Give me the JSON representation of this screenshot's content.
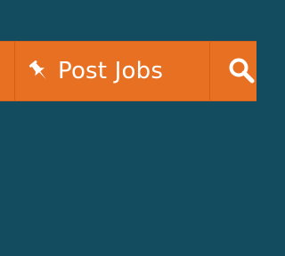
{
  "nav": {
    "post_jobs_label": "Post Jobs",
    "post_jobs_icon": "pushpin-icon",
    "search_icon": "search-icon"
  },
  "colors": {
    "background": "#134b5f",
    "navbar": "#e87023",
    "text": "#ffffff"
  }
}
